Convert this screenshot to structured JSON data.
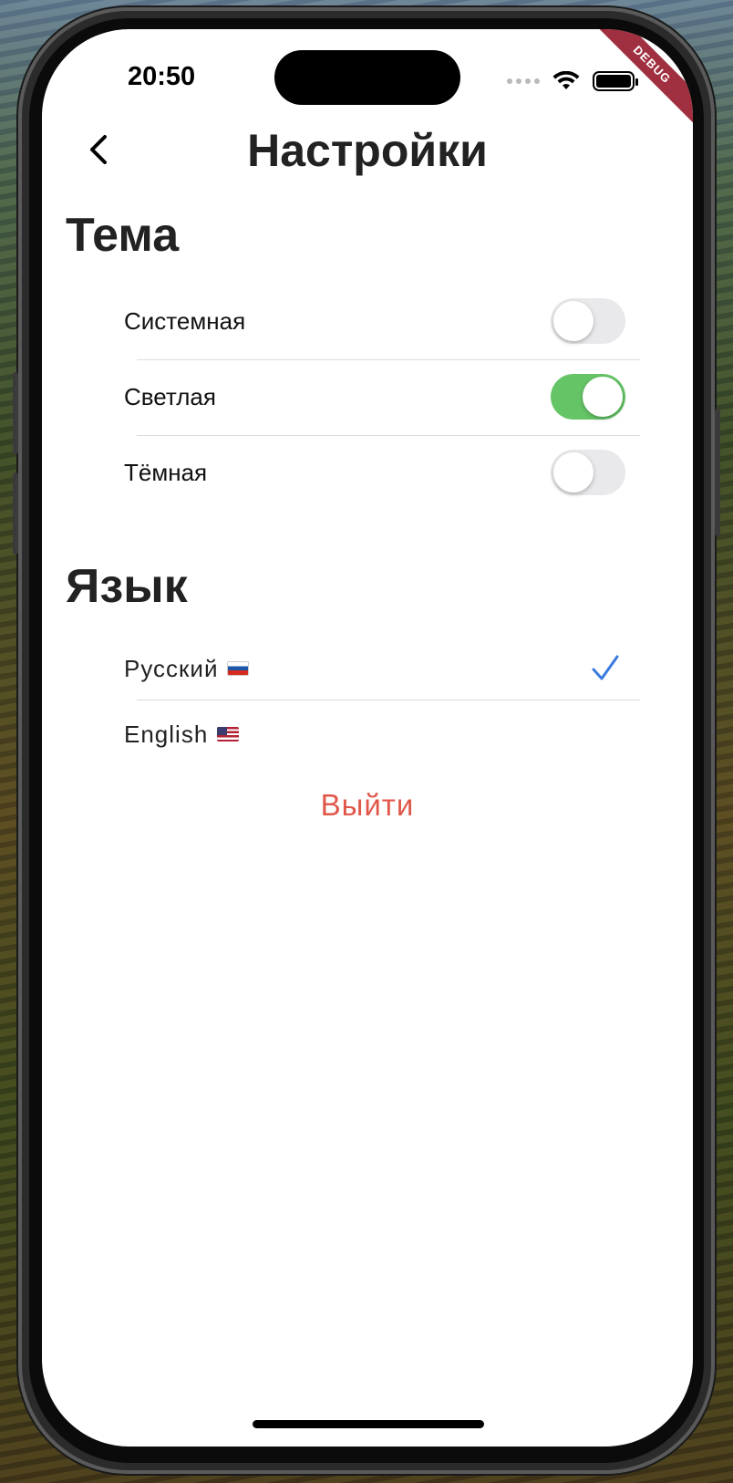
{
  "status_bar": {
    "time": "20:50",
    "icons": [
      "signal-dots-icon",
      "wifi-icon",
      "battery-icon"
    ]
  },
  "debug_banner": "DEBUG",
  "header": {
    "back_icon": "chevron-left-icon",
    "title": "Настройки"
  },
  "theme_section": {
    "title": "Тема",
    "options": [
      {
        "label": "Системная",
        "enabled": false
      },
      {
        "label": "Светлая",
        "enabled": true
      },
      {
        "label": "Тёмная",
        "enabled": false
      }
    ]
  },
  "language_section": {
    "title": "Язык",
    "options": [
      {
        "label": "Русский",
        "flag": "russia-flag-icon",
        "selected": true
      },
      {
        "label": "English",
        "flag": "usa-flag-icon",
        "selected": false
      }
    ]
  },
  "logout_label": "Выйти",
  "colors": {
    "toggle_on": "#65c466",
    "toggle_off": "#e9e9eb",
    "check": "#3b7be0",
    "logout": "#e0574a",
    "debug_ribbon": "#a03040"
  }
}
